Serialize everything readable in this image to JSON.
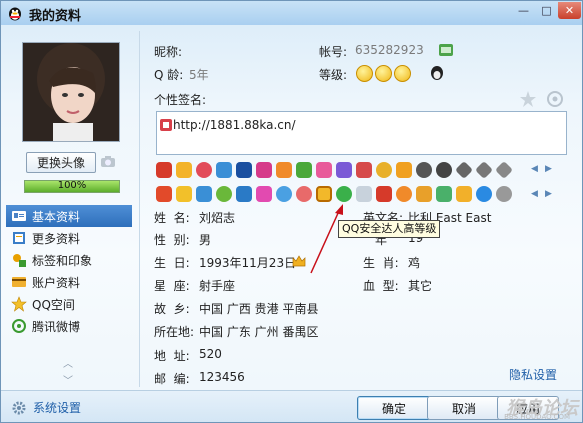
{
  "window": {
    "title": "我的资料"
  },
  "title_buttons": {
    "minimize": "—",
    "maximize": "□",
    "close": "✕"
  },
  "profile": {
    "change_avatar": "更换头像",
    "progress_label": "100%",
    "progress_value": 1.0
  },
  "nav": {
    "items": [
      {
        "label": "基本资料",
        "icon": "id-card-icon",
        "active": true
      },
      {
        "label": "更多资料",
        "icon": "notebook-icon"
      },
      {
        "label": "标签和印象",
        "icon": "tag-icon"
      },
      {
        "label": "账户资料",
        "icon": "account-icon"
      },
      {
        "label": "QQ空间",
        "icon": "star-space-icon"
      },
      {
        "label": "腾讯微博",
        "icon": "weibo-icon"
      }
    ]
  },
  "info_header": {
    "nickname_label": "昵称:",
    "account_label": "帐号:",
    "account_value": "635282923",
    "qq_age_label": "Q 龄:",
    "qq_age_value": "5年",
    "level_label": "等级:",
    "signature_label": "个性签名:",
    "signature_value": "http://1881.88ka.cn/"
  },
  "tooltip": "QQ安全达人高等级",
  "details": {
    "name": {
      "key": "姓  名:",
      "value": "刘炤志"
    },
    "english": {
      "key": "英文名:",
      "value": "比利 East East"
    },
    "gender": {
      "key": "性  别:",
      "value": "男"
    },
    "age_partial": {
      "key": "年",
      "value": "19"
    },
    "birthday": {
      "key": "生  日:",
      "value": "1993年11月23日"
    },
    "zodiac": {
      "key": "生  肖:",
      "value": "鸡"
    },
    "constellation": {
      "key": "星  座:",
      "value": "射手座"
    },
    "blood": {
      "key": "血  型:",
      "value": "其它"
    },
    "hometown": {
      "key": "故  乡:",
      "value": "中国  广西  贵港  平南县"
    },
    "location": {
      "key": "所在地:",
      "value": "中国  广东  广州  番禺区"
    },
    "address": {
      "key": "地  址:",
      "value": "520"
    },
    "postcode": {
      "key": "邮  编:",
      "value": "123456"
    }
  },
  "privacy_link": "隐私设置",
  "footer": {
    "system_settings": "系统设置",
    "ok": "确定",
    "cancel": "取消",
    "apply": "应用"
  },
  "watermark": {
    "main": "猴岛论坛",
    "small": "BBS.HOUDAO.COM"
  },
  "colors": {
    "accent": "#2e6fbb",
    "titlebar": "#a9cff0",
    "link": "#1f5fa8"
  }
}
